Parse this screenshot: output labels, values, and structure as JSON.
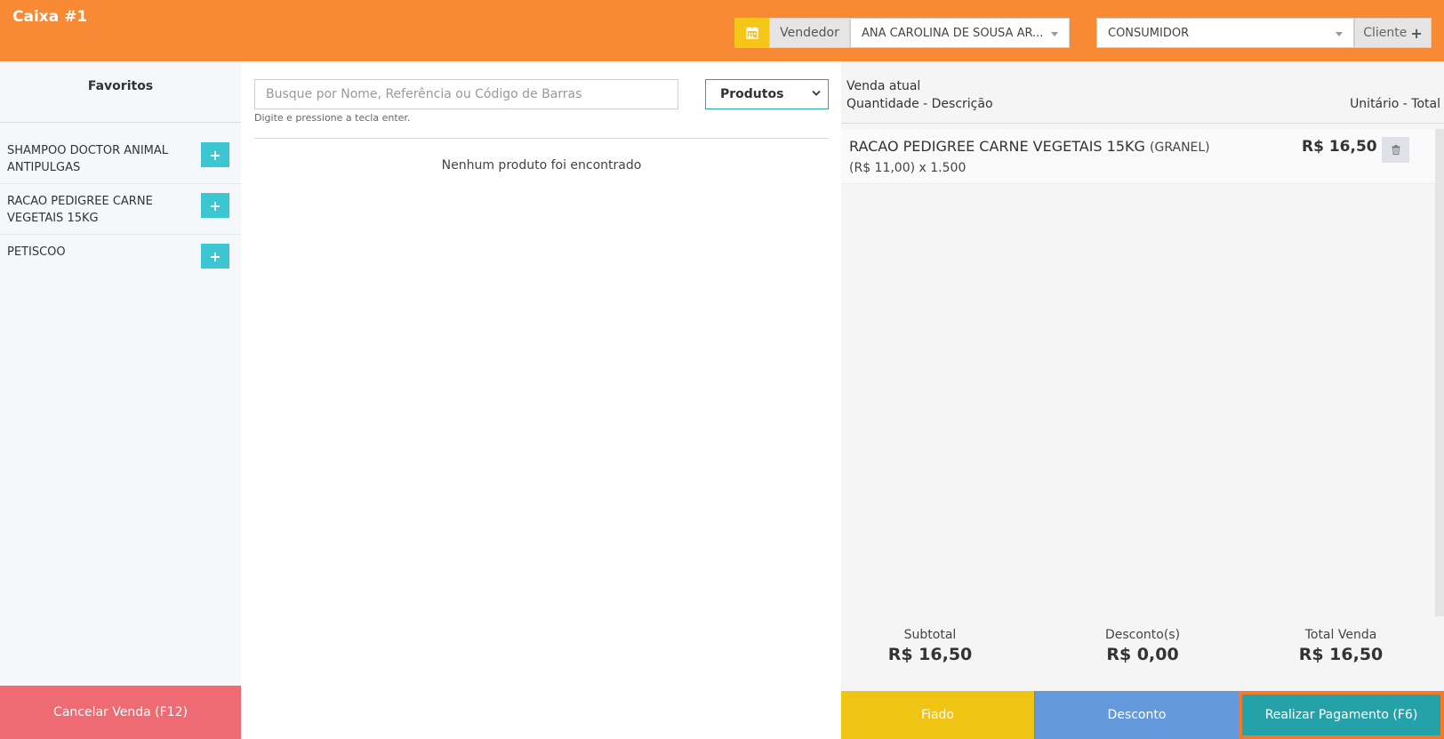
{
  "header": {
    "title": "Caixa #1",
    "vendedor_label": "Vendedor",
    "vendedor_value": "ANA CAROLINA DE SOUSA AR...",
    "cliente_value": "CONSUMIDOR",
    "cliente_button": "Cliente",
    "colors": {
      "bar": "#f88a36",
      "calendar": "#f5c518"
    }
  },
  "favoritos": {
    "title": "Favoritos",
    "items": [
      {
        "name": "SHAMPOO DOCTOR ANIMAL ANTIPULGAS",
        "add": "+"
      },
      {
        "name": "RACAO PEDIGREE CARNE VEGETAIS 15KG",
        "add": "+"
      },
      {
        "name": "PETISCOO",
        "add": "+"
      }
    ],
    "cancel_label": "Cancelar Venda (F12)"
  },
  "search": {
    "placeholder": "Busque por Nome, Referência ou Código de Barras",
    "hint": "Digite e pressione a tecla enter.",
    "category": "Produtos",
    "empty_message": "Nenhum produto foi encontrado"
  },
  "venda": {
    "title": "Venda atual",
    "col_left": "Quantidade - Descrição",
    "col_right": "Unitário - Total",
    "items": [
      {
        "description": "RACAO PEDIGREE CARNE VEGETAIS 15KG",
        "unit_type": "(GRANEL)",
        "detail": "(R$ 11,00) x 1.500",
        "total": "R$ 16,50"
      }
    ],
    "subtotal_label": "Subtotal",
    "subtotal_value": "R$ 16,50",
    "desconto_label": "Desconto(s)",
    "desconto_value": "R$ 0,00",
    "total_label": "Total Venda",
    "total_value": "R$ 16,50"
  },
  "actions": {
    "fiado": "Fiado",
    "desconto": "Desconto",
    "pagamento": "Realizar Pagamento (F6)"
  }
}
